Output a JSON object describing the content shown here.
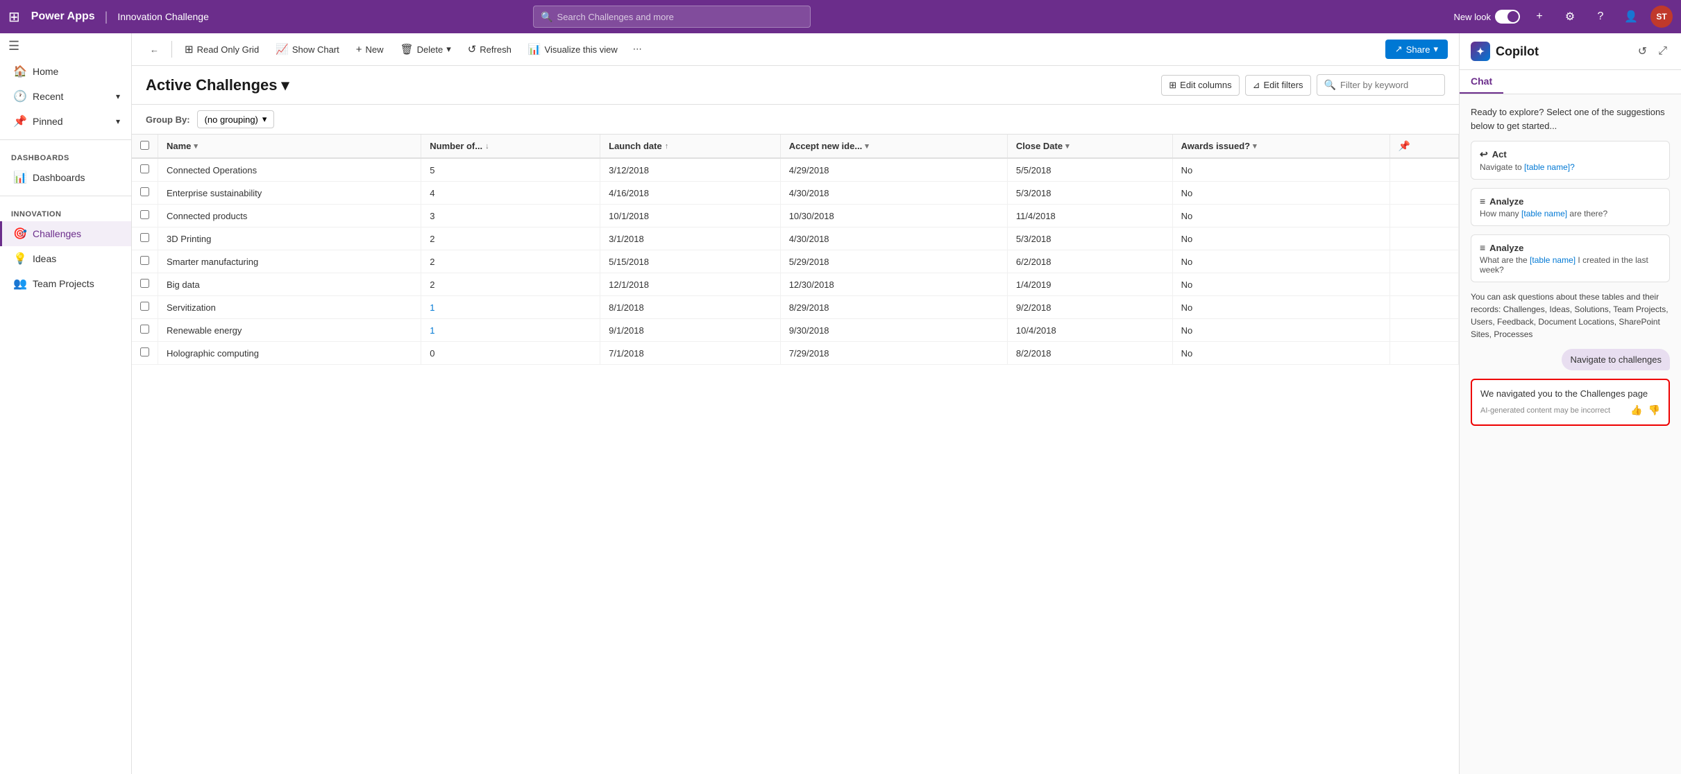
{
  "topNav": {
    "appName": "Power Apps",
    "separator": "|",
    "envName": "Innovation Challenge",
    "searchPlaceholder": "Search Challenges and more",
    "newLook": "New look",
    "addIcon": "+",
    "settingsIcon": "⚙",
    "helpIcon": "?",
    "userIcon": "👤",
    "avatarInitials": "ST"
  },
  "sidebar": {
    "collapseIcon": "☰",
    "items": [
      {
        "id": "home",
        "label": "Home",
        "icon": "🏠",
        "hasChevron": false
      },
      {
        "id": "recent",
        "label": "Recent",
        "icon": "🕐",
        "hasChevron": true
      },
      {
        "id": "pinned",
        "label": "Pinned",
        "icon": "📌",
        "hasChevron": true
      }
    ],
    "sections": [
      {
        "id": "dashboards",
        "label": "Dashboards",
        "items": [
          {
            "id": "dashboards-item",
            "label": "Dashboards",
            "icon": "📊"
          }
        ]
      },
      {
        "id": "innovation",
        "label": "Innovation",
        "items": [
          {
            "id": "challenges",
            "label": "Challenges",
            "icon": "🎯",
            "active": true
          },
          {
            "id": "ideas",
            "label": "Ideas",
            "icon": "💡"
          },
          {
            "id": "team-projects",
            "label": "Team Projects",
            "icon": "👥"
          }
        ]
      }
    ]
  },
  "toolbar": {
    "backIcon": "←",
    "readOnlyGrid": "Read Only Grid",
    "showChart": "Show Chart",
    "new": "New",
    "delete": "Delete",
    "refresh": "Refresh",
    "visualizeThisView": "Visualize this view",
    "moreIcon": "⋯",
    "share": "Share",
    "shareIcon": "↗"
  },
  "gridHeader": {
    "title": "Active Challenges",
    "chevron": "▾",
    "editColumns": "Edit columns",
    "editFilters": "Edit filters",
    "filterPlaceholder": "Filter by keyword"
  },
  "groupBy": {
    "label": "Group By:",
    "value": "(no grouping)",
    "chevron": "▾"
  },
  "table": {
    "columns": [
      {
        "id": "name",
        "label": "Name",
        "sortIcon": "▾"
      },
      {
        "id": "number",
        "label": "Number of...",
        "sortIcon": "↓"
      },
      {
        "id": "launchDate",
        "label": "Launch date",
        "sortIcon": "↑"
      },
      {
        "id": "acceptNewIdea",
        "label": "Accept new ide...",
        "sortIcon": "▾"
      },
      {
        "id": "closeDate",
        "label": "Close Date",
        "sortIcon": "▾"
      },
      {
        "id": "awardsIssued",
        "label": "Awards issued?",
        "sortIcon": "▾"
      }
    ],
    "rows": [
      {
        "name": "Connected Operations",
        "number": "5",
        "launchDate": "3/12/2018",
        "acceptNewIdea": "4/29/2018",
        "closeDate": "5/5/2018",
        "awardsIssued": "No",
        "isLink": false
      },
      {
        "name": "Enterprise sustainability",
        "number": "4",
        "launchDate": "4/16/2018",
        "acceptNewIdea": "4/30/2018",
        "closeDate": "5/3/2018",
        "awardsIssued": "No",
        "isLink": false
      },
      {
        "name": "Connected products",
        "number": "3",
        "launchDate": "10/1/2018",
        "acceptNewIdea": "10/30/2018",
        "closeDate": "11/4/2018",
        "awardsIssued": "No",
        "isLink": false
      },
      {
        "name": "3D Printing",
        "number": "2",
        "launchDate": "3/1/2018",
        "acceptNewIdea": "4/30/2018",
        "closeDate": "5/3/2018",
        "awardsIssued": "No",
        "isLink": false
      },
      {
        "name": "Smarter manufacturing",
        "number": "2",
        "launchDate": "5/15/2018",
        "acceptNewIdea": "5/29/2018",
        "closeDate": "6/2/2018",
        "awardsIssued": "No",
        "isLink": false
      },
      {
        "name": "Big data",
        "number": "2",
        "launchDate": "12/1/2018",
        "acceptNewIdea": "12/30/2018",
        "closeDate": "1/4/2019",
        "awardsIssued": "No",
        "isLink": false
      },
      {
        "name": "Servitization",
        "number": "1",
        "launchDate": "8/1/2018",
        "acceptNewIdea": "8/29/2018",
        "closeDate": "9/2/2018",
        "awardsIssued": "No",
        "isLink": true
      },
      {
        "name": "Renewable energy",
        "number": "1",
        "launchDate": "9/1/2018",
        "acceptNewIdea": "9/30/2018",
        "closeDate": "10/4/2018",
        "awardsIssued": "No",
        "isLink": true
      },
      {
        "name": "Holographic computing",
        "number": "0",
        "launchDate": "7/1/2018",
        "acceptNewIdea": "7/29/2018",
        "closeDate": "8/2/2018",
        "awardsIssued": "No",
        "isLink": false
      }
    ]
  },
  "copilot": {
    "title": "Copilot",
    "tabs": [
      "Chat"
    ],
    "intro": "Ready to explore? Select one of the suggestions below to get started...",
    "suggestions": [
      {
        "type": "Act",
        "icon": "↩",
        "text": "Navigate to [table name]?"
      },
      {
        "type": "Analyze",
        "icon": "≡",
        "text": "How many [table name] are there?"
      },
      {
        "type": "Analyze",
        "icon": "≡",
        "text": "What are the [table name] I created in the last week?"
      }
    ],
    "footerText": "You can ask questions about these tables and their records: Challenges, Ideas, Solutions, Team Projects, Users, Feedback, Document Locations, SharePoint Sites, Processes",
    "chatBubble": "Navigate to challenges",
    "response": "We navigated you to the Challenges page",
    "disclaimer": "AI-generated content may be incorrect",
    "thumbUpIcon": "👍",
    "thumbDownIcon": "👎"
  }
}
